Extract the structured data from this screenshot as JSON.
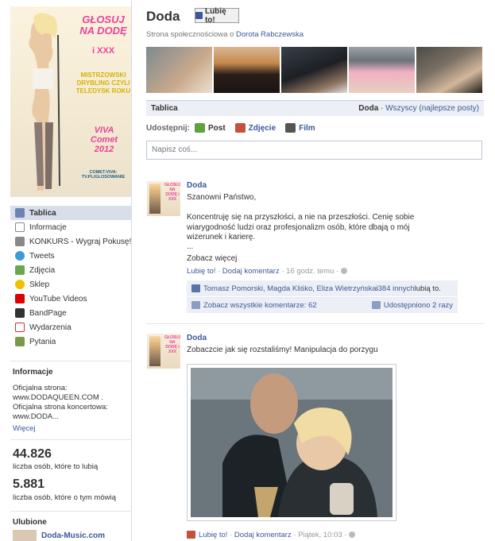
{
  "profile_picture": {
    "line1": "GŁOSUJ NA DODĘ",
    "line2": "i XXX",
    "line3": "MISTRZOWSKI DRYBLING CZYLI TELEDYSK ROKU",
    "line4": "VIVA Comet 2012",
    "line5": "COMET.VIVA-TV.PL/GLOSOWANIE"
  },
  "nav": [
    {
      "label": "Tablica",
      "icon": "wall-icon",
      "selected": true
    },
    {
      "label": "Informacje",
      "icon": "info-icon"
    },
    {
      "label": "KONKURS - Wygraj Pokusę!",
      "icon": "contest-icon"
    },
    {
      "label": "Tweets",
      "icon": "twitter-bird-icon"
    },
    {
      "label": "Zdjęcia",
      "icon": "photos-icon"
    },
    {
      "label": "Sklep",
      "icon": "shop-icon"
    },
    {
      "label": "YouTube Videos",
      "icon": "youtube-icon"
    },
    {
      "label": "BandPage",
      "icon": "bandpage-icon"
    },
    {
      "label": "Wydarzenia",
      "icon": "calendar-icon"
    },
    {
      "label": "Pytania",
      "icon": "questions-icon"
    }
  ],
  "info": {
    "heading": "Informacje",
    "text1": "Oficjalna strona:",
    "text2": "www.DODAQUEEN.COM .",
    "text3": "Oficjalna strona koncertowa:",
    "text4": "www.DODA...",
    "more": "Więcej"
  },
  "stats": {
    "likes_count": "44.826",
    "likes_label": "liczba osób, które to lubią",
    "talking_count": "5.881",
    "talking_label": "liczba osób, które o tym mówią"
  },
  "favorites": {
    "heading": "Ulubione",
    "item": "Doda-Music.com"
  },
  "header": {
    "name": "Doda",
    "like_button": "Lubię to!",
    "subtitle_prefix": "Strona społecznościowa o",
    "subtitle_link": "Dorota Rabczewska"
  },
  "tabbar": {
    "title": "Tablica",
    "filter_author": "Doda",
    "filter_sep": " · ",
    "filter_option": "Wszyscy (najlepsze posty)"
  },
  "share": {
    "label": "Udostępnij:",
    "post": "Post",
    "photo": "Zdjęcie",
    "video": "Film",
    "placeholder": "Napisz coś..."
  },
  "post1": {
    "author": "Doda",
    "greeting": "Szanowni Państwo,",
    "body": "Koncentruję się na przyszłości, a nie na przeszłości. Cenię sobie wiarygodność ludzi oraz profesjonalizm osób, które dbają o mój wizerunek i karierę.",
    "ellipsis": "...",
    "see_more": "Zobacz więcej",
    "like": "Lubię to!",
    "comment": "Dodaj komentarz",
    "time": "16 godz. temu",
    "likes_names": "Tomasz Pomorski, Magda Kliśko, Eliza Wietrzyńska",
    "likes_and": " i ",
    "likes_others": "384 innych",
    "likes_suffix": " lubią to.",
    "view_comments": "Zobacz wszystkie komentarze: 62",
    "shared": "Udostępniono 2 razy"
  },
  "post2": {
    "author": "Doda",
    "body": "Zobaczcie jak się rozstaliśmy! Manipulacja do porzygu",
    "like": "Lubię to!",
    "comment": "Dodaj komentarz",
    "time": "Piątek, 10:03"
  },
  "colors": {
    "link": "#3b5998",
    "tab_bg": "#eceff5",
    "nav_selected": "#d8dfea"
  }
}
